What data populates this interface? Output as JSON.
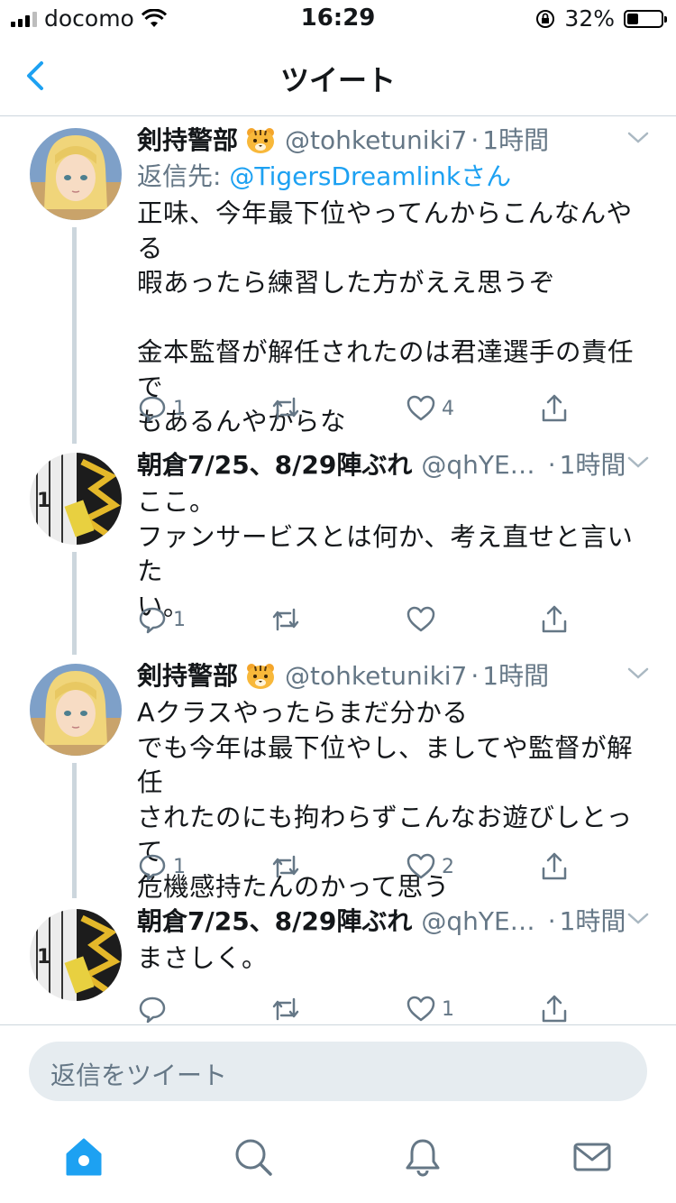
{
  "status_bar": {
    "carrier": "docomo",
    "time": "16:29",
    "battery": "32%"
  },
  "nav": {
    "title": "ツイート"
  },
  "colors": {
    "accent": "#1da1f2",
    "muted": "#657786",
    "divider": "#ccd6dd"
  },
  "tweets": [
    {
      "name": "剣持警部",
      "emoji": "tiger-face-icon",
      "handle": "@tohketuniki7",
      "sep": "·",
      "time": "1時間",
      "reply_prefix": "返信先: ",
      "reply_to": "@TigersDreamlinkさん",
      "text": "正味、今年最下位やってんからこんなんやる\n暇あったら練習した方がええ思うぞ\n\n金本監督が解任されたのは君達選手の責任で\nもあるんやからな",
      "replies": "1",
      "retweets": "",
      "likes": "4"
    },
    {
      "name": "朝倉7/25、8/29陣ぶれ",
      "handle": "@qhYE…",
      "sep": "·",
      "time": "1時間",
      "text": "ここ。\nファンサービスとは何か、考え直せと言いた\nい。",
      "replies": "1",
      "retweets": "",
      "likes": ""
    },
    {
      "name": "剣持警部",
      "emoji": "tiger-face-icon",
      "handle": "@tohketuniki7",
      "sep": "·",
      "time": "1時間",
      "text": "Aクラスやったらまだ分かる\nでも今年は最下位やし、ましてや監督が解任\nされたのにも拘わらずこんなお遊びしとって\n危機感持たんのかって思う",
      "replies": "1",
      "retweets": "",
      "likes": "2"
    },
    {
      "name": "朝倉7/25、8/29陣ぶれ",
      "handle": "@qhYE…",
      "sep": "·",
      "time": "1時間",
      "text": "まさしく。",
      "replies": "",
      "retweets": "",
      "likes": "1"
    }
  ],
  "reply_bar": {
    "placeholder": "返信をツイート"
  },
  "tab_bar": {
    "items": [
      "home-icon",
      "search-icon",
      "notifications-icon",
      "messages-icon"
    ]
  }
}
